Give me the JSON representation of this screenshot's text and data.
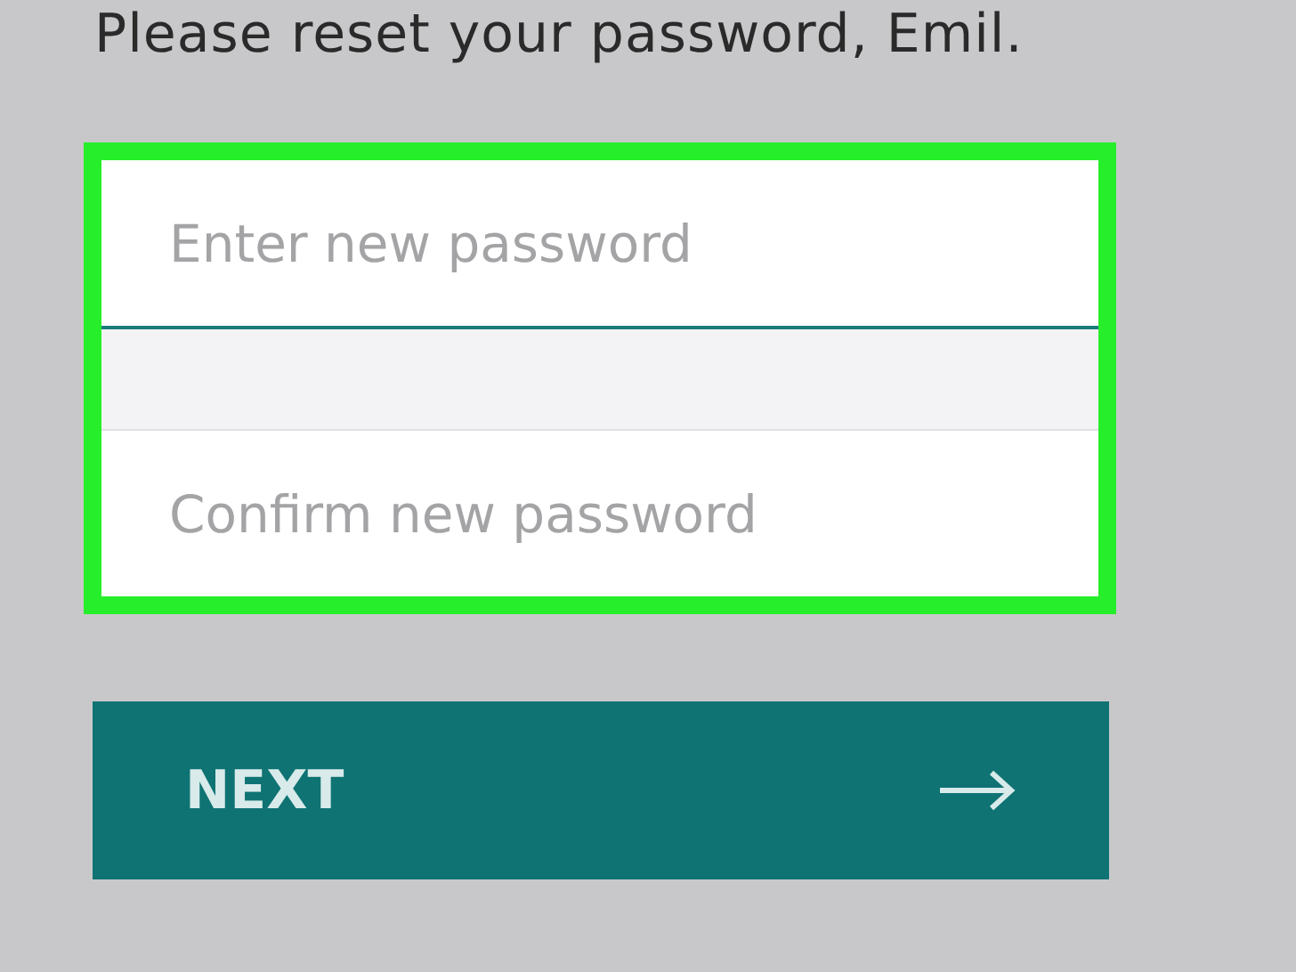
{
  "heading": "Please reset your password, Emil.",
  "fields": [
    {
      "placeholder": "Enter new password"
    },
    {
      "placeholder": "Confirm new password"
    }
  ],
  "button": {
    "label": "NEXT"
  }
}
